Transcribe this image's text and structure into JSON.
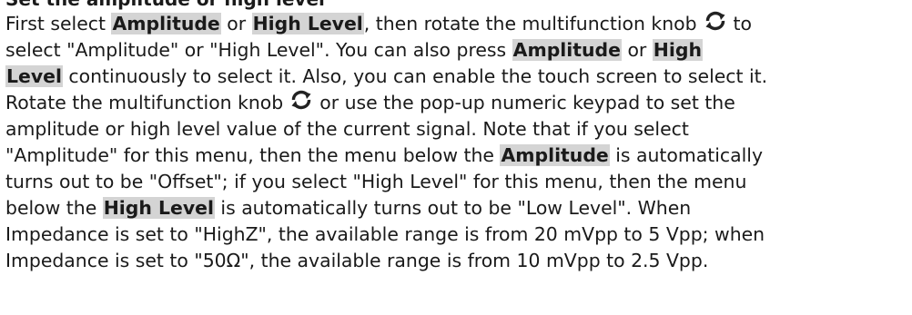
{
  "heading": "Set the amplitude or high level",
  "icons": {
    "knob": "multifunction-knob-rotate-icon"
  },
  "lines": [
    [
      "First select ",
      {
        "btn": "Amplitude"
      },
      " or ",
      {
        "btn": "High Level"
      },
      ", then rotate the multifunction knob",
      {
        "icon": "knob"
      },
      "to"
    ],
    [
      "select \"Amplitude\" or \"High Level\". You can also press ",
      {
        "btn": "Amplitude"
      },
      " or ",
      {
        "btn": "High "
      }
    ],
    [
      {
        "btn": "Level"
      },
      " continuously to select it. Also, you can enable the touch screen to select it."
    ],
    [
      "Rotate the multifunction knob",
      {
        "icon": "knob"
      },
      "or use the pop-up numeric keypad to set the"
    ],
    [
      "amplitude or high level value of the current signal. Note that if you select"
    ],
    [
      "\"Amplitude\" for this menu, then the menu below the ",
      {
        "btn": "Amplitude"
      },
      " is automatically"
    ],
    [
      "turns out to be \"Offset\"; if you select \"High Level\" for this menu, then the menu"
    ],
    [
      "below the ",
      {
        "btn": "High Level"
      },
      " is automatically turns out to be \"Low Level\". When"
    ],
    [
      "Impedance is set to \"HighZ\", the available range is from 20 mVpp to 5 Vpp; when"
    ],
    [
      "Impedance is set to \"50Ω\", the available range is from 10 mVpp to 2.5 Vpp."
    ]
  ]
}
